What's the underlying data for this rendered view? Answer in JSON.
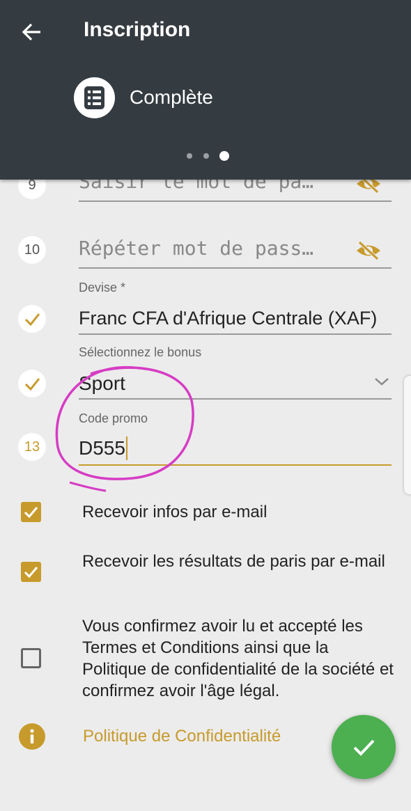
{
  "header": {
    "title": "Inscription",
    "step_label": "Complète",
    "step_dots": 3,
    "active_dot": 3
  },
  "form": {
    "password": {
      "number": "9",
      "placeholder": "Saisir le mot de pa…"
    },
    "repeat_password": {
      "number": "10",
      "placeholder": "Répéter mot de pass…"
    },
    "currency": {
      "label": "Devise *",
      "value": "Franc CFA d'Afrique Centrale (XAF)"
    },
    "bonus": {
      "label": "Sélectionnez le bonus",
      "value": "Sport"
    },
    "promo": {
      "number": "13",
      "label": "Code promo",
      "value": "D555"
    }
  },
  "checkboxes": [
    {
      "label": "Recevoir infos par e-mail",
      "checked": true
    },
    {
      "label": "Recevoir les résultats de paris par e-mail",
      "checked": true
    },
    {
      "label": "Vous confirmez avoir lu et accepté les Termes et Conditions ainsi que la Politique de confidentialité de la société et confirmez avoir l'âge légal.",
      "checked": false
    }
  ],
  "policy_link": "Politique de Confidentialité",
  "colors": {
    "header_bg": "#353c41",
    "accent": "#c79a2c",
    "fab": "#4caf50",
    "annotation": "#d63cc4"
  }
}
